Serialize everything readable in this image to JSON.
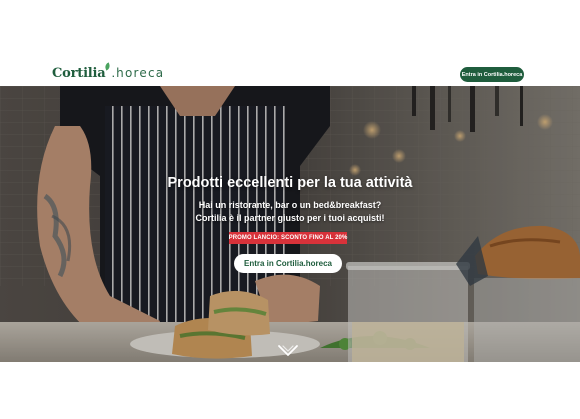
{
  "header": {
    "logo": {
      "brand": "Cortilia",
      "separator": ".",
      "suffix": "horeca"
    },
    "cta_label": "Entra in Cortilia.horeca"
  },
  "hero": {
    "title": "Prodotti eccellenti per la tua attività",
    "subtitle_line1": "Hai un ristorante, bar o un bed&breakfast?",
    "subtitle_line2": "Cortilia è il partner giusto per i tuoi acquisti!",
    "promo_label": "PROMO LANCIO: SCONTO FINO AL 20%",
    "cta_label": "Entra in Cortilia.horeca",
    "scroll_icon": "chevron-down-icon"
  },
  "colors": {
    "brand_green": "#1f5d3d",
    "leaf_green": "#4aa35f",
    "promo_red": "#d8323a",
    "white": "#ffffff"
  }
}
